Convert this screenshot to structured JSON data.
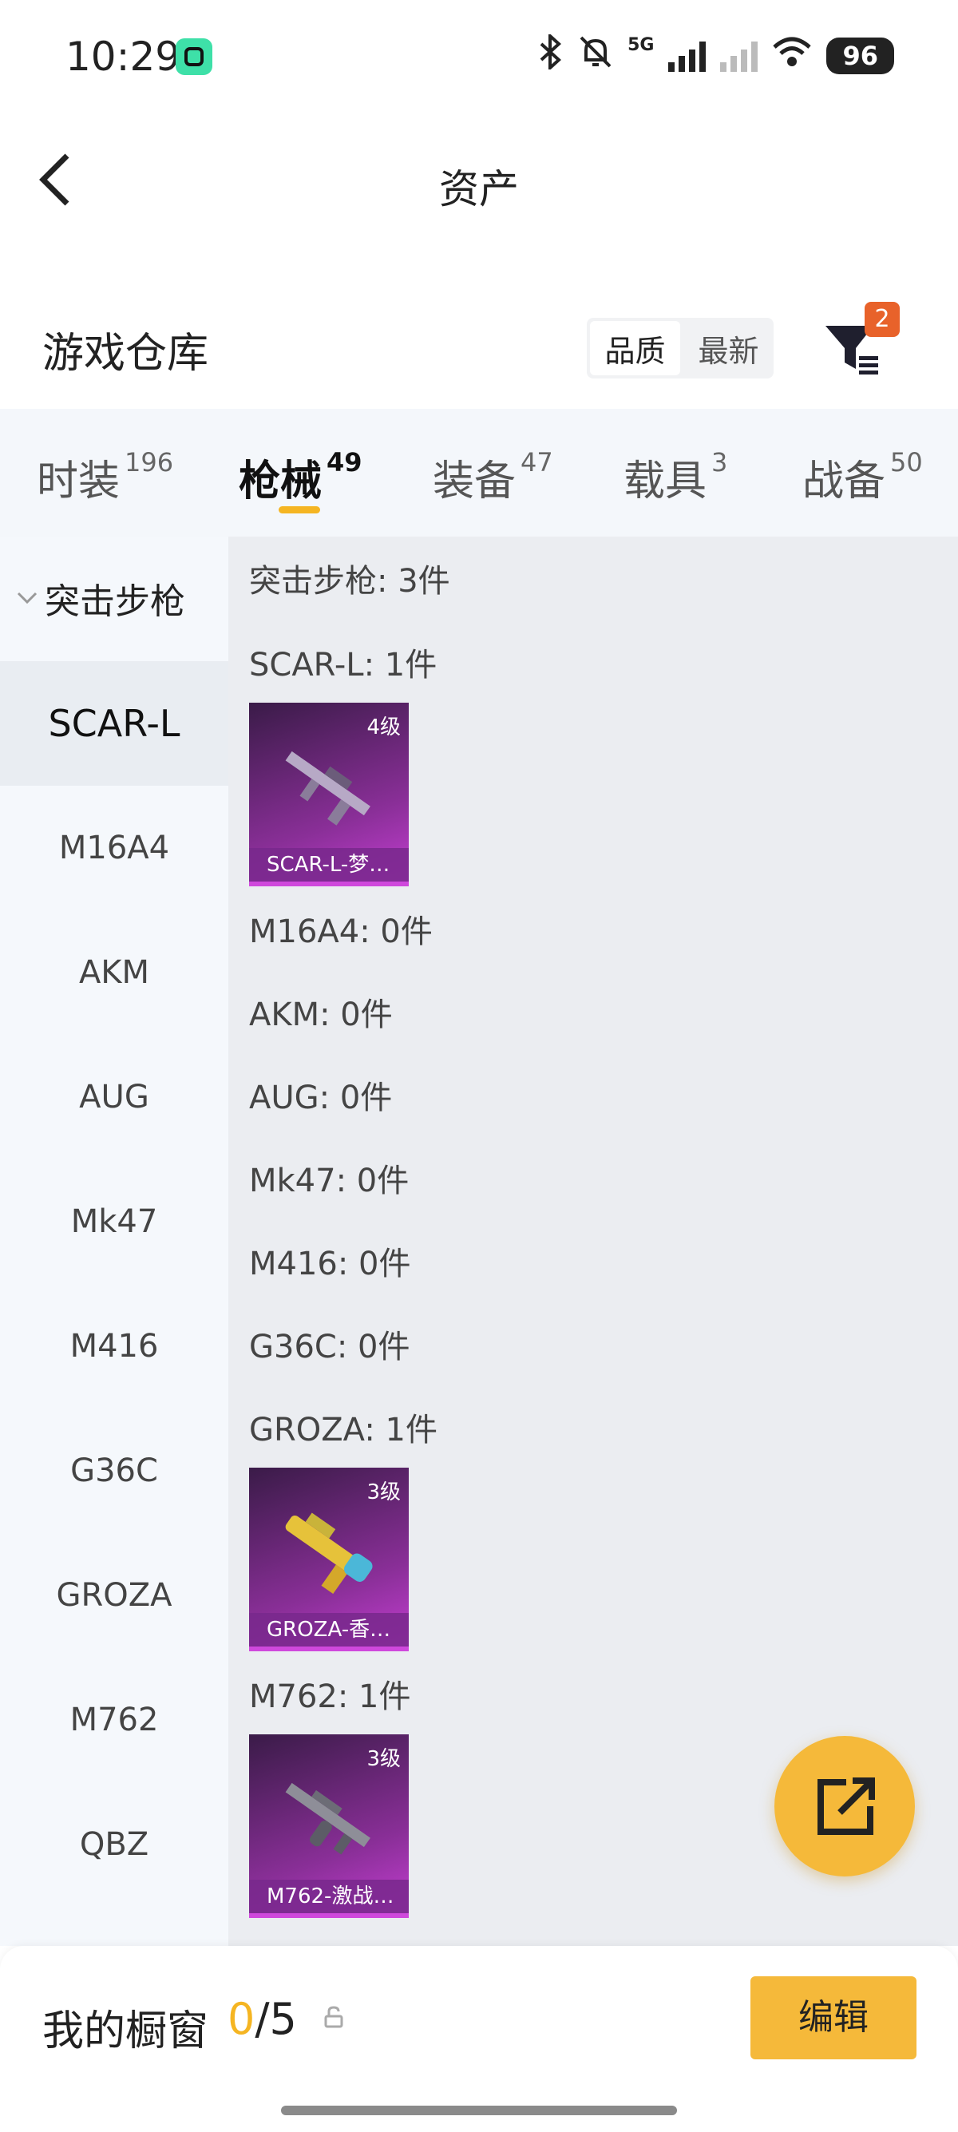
{
  "status_bar": {
    "time": "10:29",
    "network": "5G",
    "battery": "96"
  },
  "header": {
    "title": "资产"
  },
  "warehouse": {
    "title": "游戏仓库",
    "sort_options": [
      "品质",
      "最新"
    ],
    "active_sort": "品质",
    "filter_badge": "2"
  },
  "tabs": [
    {
      "label": "时装",
      "count": "196"
    },
    {
      "label": "枪械",
      "count": "49",
      "active": true
    },
    {
      "label": "装备",
      "count": "47"
    },
    {
      "label": "载具",
      "count": "3"
    },
    {
      "label": "战备",
      "count": "50"
    }
  ],
  "sidebar": {
    "category": "突击步枪",
    "items": [
      "SCAR-L",
      "M16A4",
      "AKM",
      "AUG",
      "Mk47",
      "M416",
      "G36C",
      "GROZA",
      "M762",
      "QBZ"
    ],
    "active": "SCAR-L"
  },
  "content": {
    "category_summary": "突击步枪: 3件",
    "groups": [
      {
        "label": "SCAR-L: 1件",
        "items": [
          {
            "level": "4级",
            "name": "SCAR-L-梦…"
          }
        ]
      },
      {
        "label": "M16A4: 0件",
        "items": []
      },
      {
        "label": "AKM: 0件",
        "items": []
      },
      {
        "label": "AUG: 0件",
        "items": []
      },
      {
        "label": "Mk47: 0件",
        "items": []
      },
      {
        "label": "M416: 0件",
        "items": []
      },
      {
        "label": "G36C: 0件",
        "items": []
      },
      {
        "label": "GROZA: 1件",
        "items": [
          {
            "level": "3级",
            "name": "GROZA-香…"
          }
        ]
      },
      {
        "label": "M762: 1件",
        "items": [
          {
            "level": "3级",
            "name": "M762-激战…"
          }
        ]
      }
    ]
  },
  "showcase": {
    "title": "我的橱窗",
    "current": "0",
    "total": "/5",
    "edit_label": "编辑"
  },
  "colors": {
    "accent": "#f5b522",
    "card_purple": "#8a2f98",
    "badge": "#e8622a"
  }
}
